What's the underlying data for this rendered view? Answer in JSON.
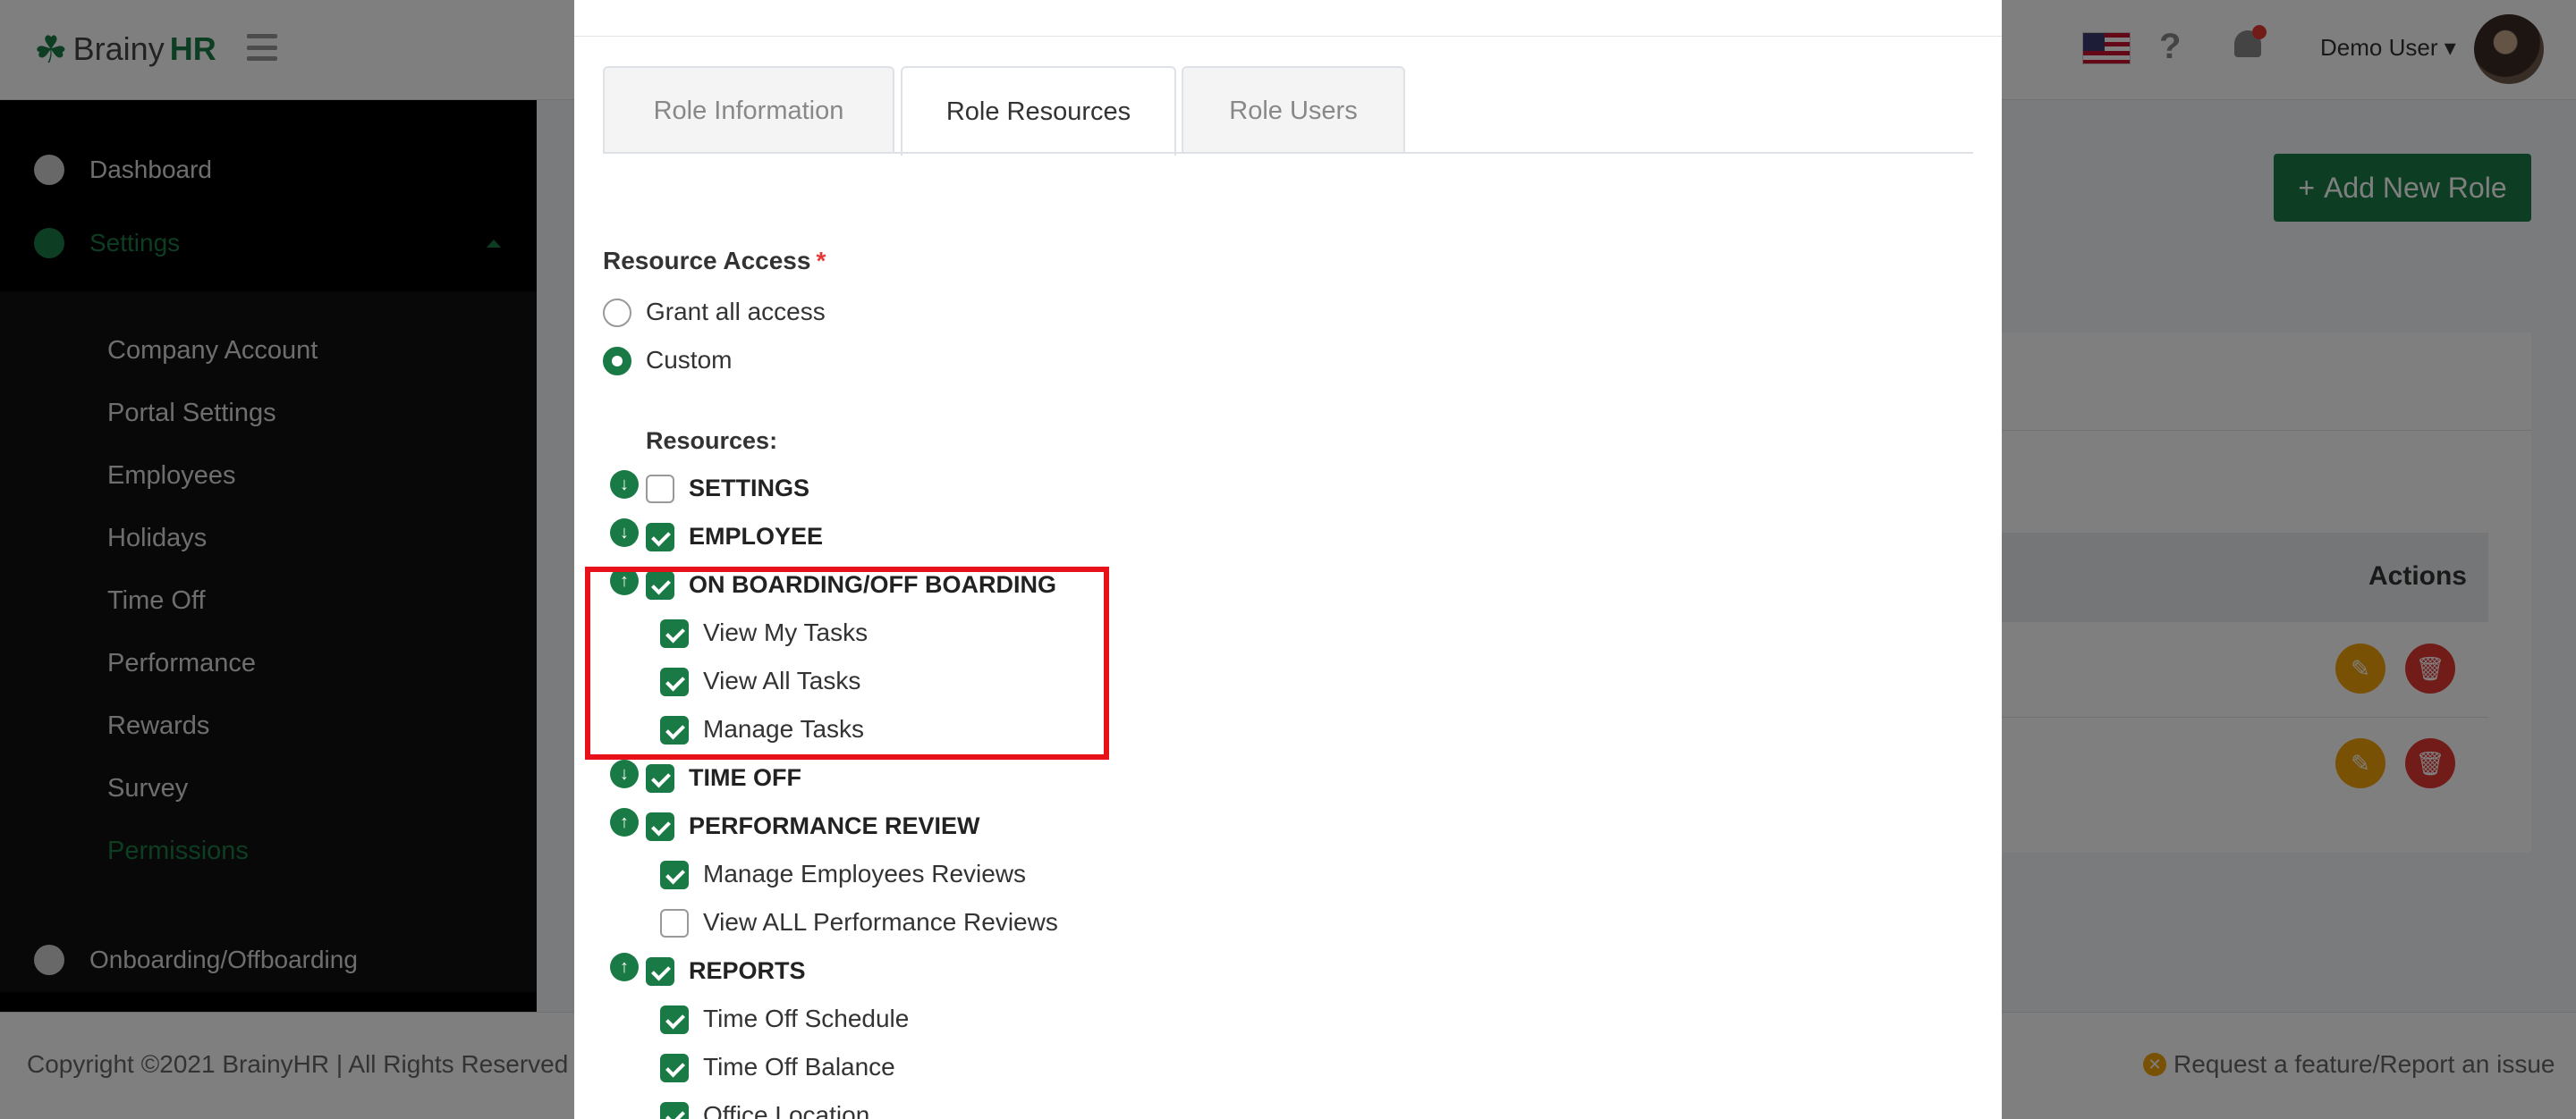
{
  "app": {
    "brand_name": "Brainy",
    "brand_suffix": "HR",
    "user_name": "Demo User",
    "help_symbol": "?",
    "add_role_label": "Add New Role",
    "actions_header": "Actions",
    "colors": {
      "brand": "#1a7a45",
      "danger": "#e53935",
      "warning": "#f0a30a",
      "sidebar": "#000000"
    }
  },
  "sidebar": {
    "dashboard": "Dashboard",
    "settings": "Settings",
    "submenu": [
      "Company Account",
      "Portal Settings",
      "Employees",
      "Holidays",
      "Time Off",
      "Performance",
      "Rewards",
      "Survey",
      "Permissions"
    ],
    "active_submenu": "Permissions",
    "onboarding": "Onboarding/Offboarding"
  },
  "footer": {
    "copyright": "Copyright ©2021 BrainyHR | All Rights Reserved",
    "report": "Request a feature/Report an issue"
  },
  "modal": {
    "tabs": [
      "Role Information",
      "Role Resources",
      "Role Users"
    ],
    "active_tab": "Role Resources",
    "resource_access_label": "Resource Access",
    "required_mark": "*",
    "options": {
      "grant_all": "Grant all access",
      "custom": "Custom"
    },
    "selected_option": "Custom",
    "resources_label": "Resources:",
    "resources": {
      "settings": {
        "label": "SETTINGS",
        "checked": false,
        "expanded": false
      },
      "employee": {
        "label": "EMPLOYEE",
        "checked": true,
        "expanded": false
      },
      "onboarding": {
        "label": "ON BOARDING/OFF BOARDING",
        "checked": true,
        "expanded": true,
        "children": [
          "View My Tasks",
          "View All Tasks",
          "Manage Tasks"
        ]
      },
      "timeoff": {
        "label": "TIME OFF",
        "checked": true,
        "expanded": false
      },
      "performance": {
        "label": "PERFORMANCE REVIEW",
        "checked": true,
        "expanded": true,
        "children": [
          "Manage Employees Reviews",
          "View ALL Performance Reviews"
        ],
        "children_checked": [
          true,
          false
        ]
      },
      "reports": {
        "label": "REPORTS",
        "checked": true,
        "expanded": true,
        "children": [
          "Time Off Schedule",
          "Time Off Balance",
          "Office Location"
        ]
      }
    }
  }
}
